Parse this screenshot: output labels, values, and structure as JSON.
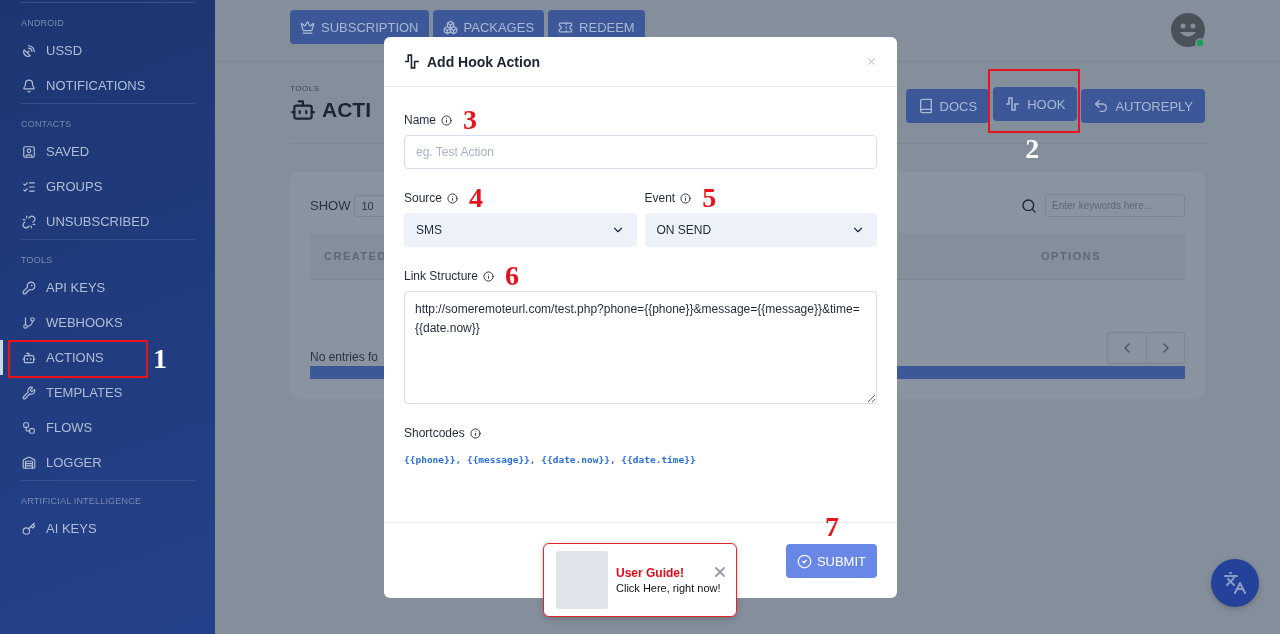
{
  "sidebar": {
    "sections": [
      {
        "title": "ANDROID",
        "items": [
          {
            "label": "USSD",
            "selected": false
          },
          {
            "label": "NOTIFICATIONS",
            "selected": false
          }
        ]
      },
      {
        "title": "CONTACTS",
        "items": [
          {
            "label": "SAVED",
            "selected": false
          },
          {
            "label": "GROUPS",
            "selected": false
          },
          {
            "label": "UNSUBSCRIBED",
            "selected": false
          }
        ]
      },
      {
        "title": "TOOLS",
        "items": [
          {
            "label": "API KEYS",
            "selected": false
          },
          {
            "label": "WEBHOOKS",
            "selected": false
          },
          {
            "label": "ACTIONS",
            "selected": true,
            "callout": "1"
          },
          {
            "label": "TEMPLATES",
            "selected": false
          },
          {
            "label": "FLOWS",
            "selected": false
          },
          {
            "label": "LOGGER",
            "selected": false
          }
        ]
      },
      {
        "title": "ARTIFICIAL INTELLIGENCE",
        "items": [
          {
            "label": "AI KEYS",
            "selected": false
          }
        ]
      }
    ]
  },
  "top_buttons": [
    {
      "label": "SUBSCRIPTION"
    },
    {
      "label": "PACKAGES"
    },
    {
      "label": "REDEEM"
    }
  ],
  "page": {
    "breadcrumb": "TOOLS",
    "title": "ACTI"
  },
  "actions": [
    {
      "label": "DOCS"
    },
    {
      "label": "HOOK",
      "callout": "2"
    },
    {
      "label": "AUTOREPLY"
    }
  ],
  "table": {
    "show_label": "SHOW",
    "page_size": "10",
    "search_placeholder": "Enter keywords here...",
    "columns": [
      "CREATED",
      "OPTIONS"
    ],
    "empty_text": "No entries fo"
  },
  "modal": {
    "title": "Add Hook Action",
    "fields": [
      {
        "kind": "text",
        "label": "Name",
        "callout": "3",
        "placeholder": "eg. Test Action"
      },
      {
        "kind": "select",
        "label": "Source",
        "callout": "4",
        "value": "SMS"
      },
      {
        "kind": "select",
        "label": "Event",
        "callout": "5",
        "value": "ON SEND"
      },
      {
        "kind": "textarea",
        "label": "Link Structure",
        "callout": "6",
        "value": "http://someremoteurl.com/test.php?phone={{phone}}&message={{message}}&time={{date.now}}"
      }
    ],
    "shortcodes_label": "Shortcodes",
    "shortcodes": "{{phone}}, {{message}}, {{date.now}}, {{date.time}}",
    "submit": {
      "label": "SUBMIT",
      "callout": "7"
    }
  },
  "user_guide": {
    "title": "User Guide!",
    "text": "Click Here, right now!"
  }
}
